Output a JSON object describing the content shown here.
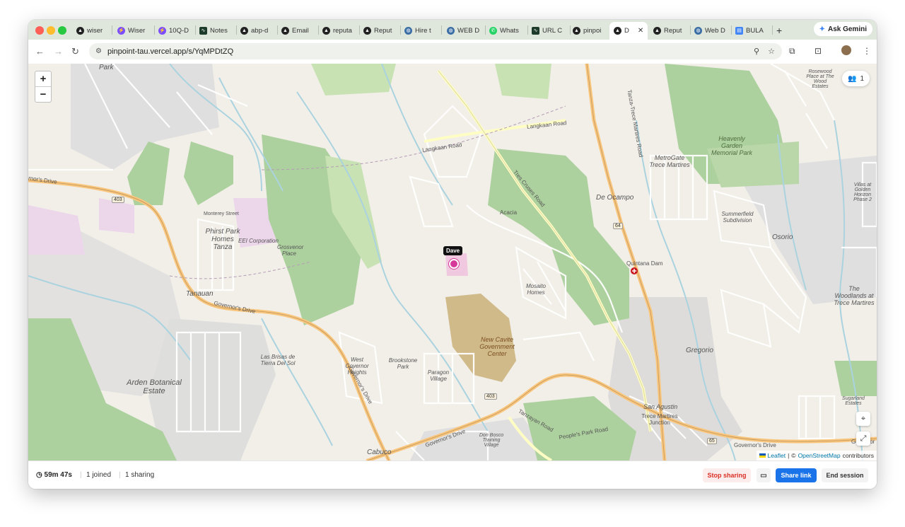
{
  "browser": {
    "tabs": [
      {
        "label": "wiser",
        "icon": "dark-circle-icon"
      },
      {
        "label": "Wiser",
        "icon": "lightning-icon"
      },
      {
        "label": "10Q-D",
        "icon": "lightning-icon"
      },
      {
        "label": "Notes",
        "icon": "chart-app-icon"
      },
      {
        "label": "abp-d",
        "icon": "dark-circle-icon"
      },
      {
        "label": "Email",
        "icon": "dark-circle-icon"
      },
      {
        "label": "reputa",
        "icon": "dark-circle-icon"
      },
      {
        "label": "Reput",
        "icon": "dark-circle-icon"
      },
      {
        "label": "Hire t",
        "icon": "globe-icon"
      },
      {
        "label": "WEB D",
        "icon": "globe-icon"
      },
      {
        "label": "Whats",
        "icon": "whatsapp-icon"
      },
      {
        "label": "URL C",
        "icon": "chart-app-icon"
      },
      {
        "label": "pinpoi",
        "icon": "dark-circle-icon"
      },
      {
        "label": "D",
        "icon": "dark-circle-icon",
        "active": true
      },
      {
        "label": "Reput",
        "icon": "dark-circle-icon"
      },
      {
        "label": "Web D",
        "icon": "globe-icon"
      },
      {
        "label": "BULA",
        "icon": "doc-icon"
      }
    ],
    "new_tab": "+",
    "ask_gemini": "Ask Gemini",
    "url": "pinpoint-tau.vercel.app/s/YqMPDtZQ"
  },
  "map": {
    "zoom_in": "+",
    "zoom_out": "−",
    "participants_count": "1",
    "marker_label": "Dave",
    "attribution": {
      "leaflet": "Leaflet",
      "separator": "|",
      "copyright": "©",
      "osm": "OpenStreetMap",
      "contributors": "contributors"
    },
    "labels": {
      "park": "Park",
      "governors_drive": "Governor's Drive",
      "rnor_drive": "rnor's Drive",
      "monterey": "Monterey Street",
      "phirst_park": "Phirst Park Homes Tanza",
      "eei": "EEI Corporation",
      "grosvenor": "Grosvenor Place",
      "tanauan": "Tanauan",
      "arden": "Arden Botanical Estate",
      "las_brisas": "Las Brisas de Tierra Del Sol",
      "west_governor": "West Governor Heights",
      "brookstone": "Brookstone Park",
      "paragon": "Paragon Village",
      "new_cavite": "New Cavite Government Center",
      "langkaan": "Langkaan Road",
      "langkaan2": "Langkaan Road",
      "tres_cruses": "Tres Cruses Road",
      "acacia": "Acacia",
      "mosaito": "Mosaito Homes",
      "de_ocampo": "De Ocampo",
      "metrogate": "MetroGate Trece Martires",
      "heavenly": "Heavenly Garden Memorial Park",
      "quintana": "Quintana Dam",
      "osorio": "Osorio",
      "summerfield": "Summerfield Subdivision",
      "woodlands": "The Woodlands at Trece Martires",
      "gregorio": "Gregorio",
      "san_agustin": "San Agustin",
      "trece_junction": "Trece Martires Junction",
      "cabuco": "Cabuco",
      "don_bosco": "Don Bosco Training Village",
      "peoples_park": "People's Park Road",
      "tanzayan": "Tanzayan Road",
      "sugarland": "Sugarland Estates",
      "villas_golden": "Villas at Golden Horizon Phase 2",
      "rosewood": "Rosewood Place at The Wood Estates",
      "tanza_trece": "Tanza-Trece Martires Road",
      "r403a": "403",
      "r403b": "403",
      "r64": "64",
      "r65": "65",
      "governor_right": "Governor's Drive",
      "governor_bottom_left": "Governor's Drive",
      "governor_far_right": "Governor"
    }
  },
  "footer": {
    "timer": "59m 47s",
    "joined": "1 joined",
    "sharing": "1 sharing",
    "stop_sharing": "Stop sharing",
    "share_link": "Share link",
    "end_session": "End session"
  },
  "colors": {
    "accent": "#1a73e8",
    "danger": "#d93025",
    "marker": "#d6399a",
    "park": "#add19e",
    "major_road": "#f9c67e",
    "water": "#aad3df"
  }
}
